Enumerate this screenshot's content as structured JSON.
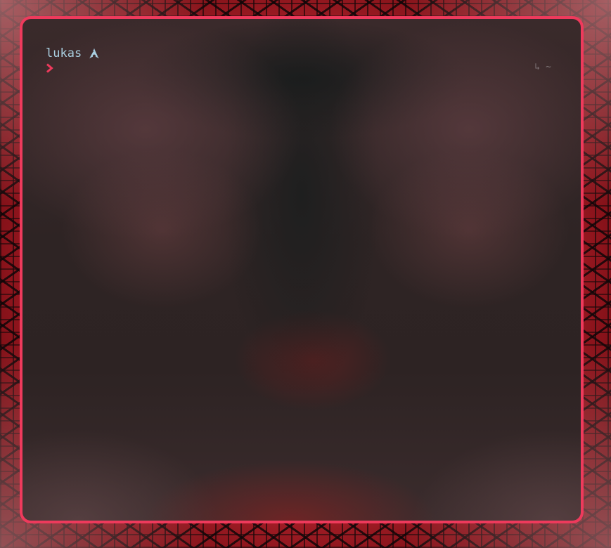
{
  "terminal": {
    "username": "lukas",
    "user_icon": "arch-linux-icon",
    "prompt_symbol_icon": "chevron-right-icon",
    "right_prompt": {
      "return_icon": "↳",
      "cwd": "~"
    }
  },
  "colors": {
    "border": "#ee3a5c",
    "username": "#a9cfe0",
    "prompt_symbol": "#ee3a5c",
    "right_prompt": "#7d7275"
  }
}
